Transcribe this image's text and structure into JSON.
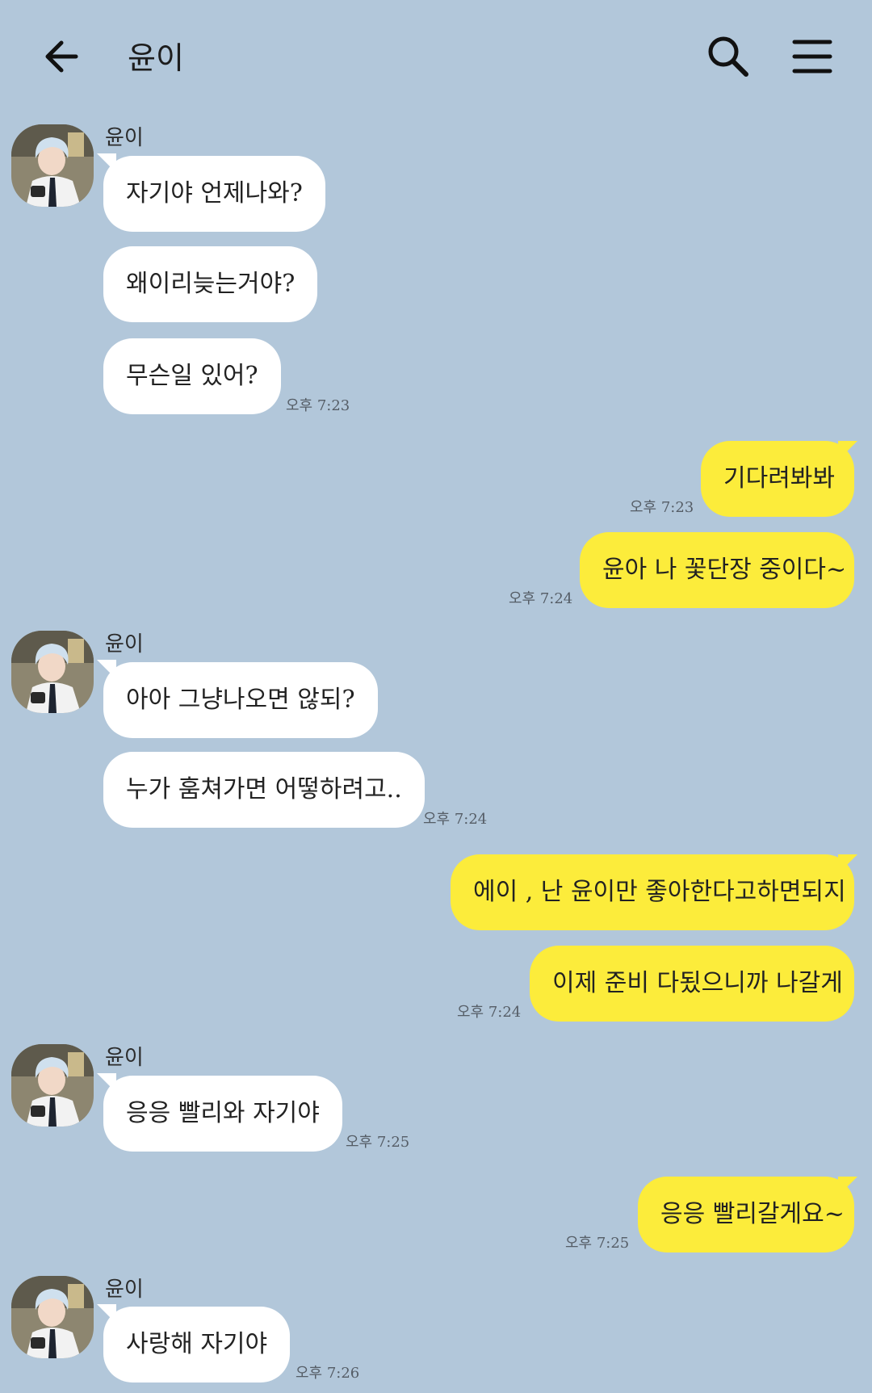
{
  "header": {
    "title": "윤이",
    "back_icon": "arrow-left-icon",
    "search_icon": "search-icon",
    "menu_icon": "hamburger-menu-icon"
  },
  "colors": {
    "background": "#b2c7da",
    "incoming_bubble": "#ffffff",
    "outgoing_bubble": "#fcec3b"
  },
  "messages": [
    {
      "sender": "윤이",
      "text": "자기야 언제나와?"
    },
    {
      "text": "왜이리늦는거야?"
    },
    {
      "text": "무슨일 있어?",
      "time": "오후 7:23"
    },
    {
      "text": "기다려봐봐",
      "time": "오후 7:23"
    },
    {
      "text": "윤아 나 꽃단장 중이다~",
      "time": "오후 7:24"
    },
    {
      "sender": "윤이",
      "text": "아아 그냥나오면 않되?"
    },
    {
      "text": "누가 훔쳐가면 어떻하려고..",
      "time": "오후 7:24"
    },
    {
      "text": "에이 , 난 윤이만 좋아한다고하면되지"
    },
    {
      "text": "이제 준비 다됬으니까 나갈게",
      "time": "오후 7:24"
    },
    {
      "sender": "윤이",
      "text": "응응 빨리와 자기야",
      "time": "오후 7:25"
    },
    {
      "text": "응응 빨리갈게요~",
      "time": "오후 7:25"
    },
    {
      "sender": "윤이",
      "text": "사랑해 자기야",
      "time": "오후 7:26"
    }
  ]
}
